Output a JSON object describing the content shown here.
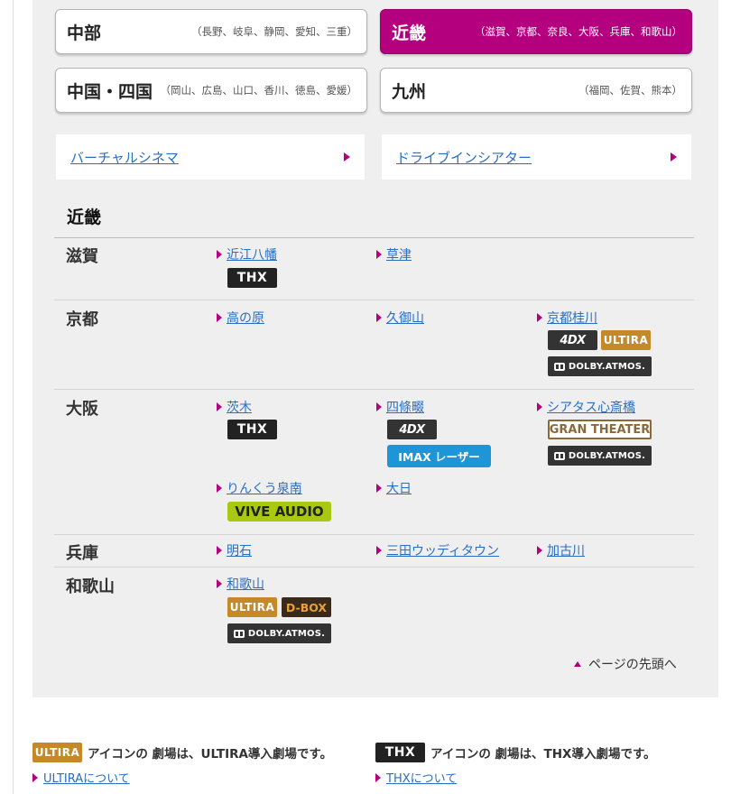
{
  "regions": [
    {
      "name": "中部",
      "prefs": "（長野、岐阜、静岡、愛知、三重）",
      "active": false
    },
    {
      "name": "近畿",
      "prefs": "（滋賀、京都、奈良、大阪、兵庫、和歌山）",
      "active": true
    },
    {
      "name": "中国・四国",
      "prefs": "（岡山、広島、山口、香川、徳島、愛媛）",
      "active": false
    },
    {
      "name": "九州",
      "prefs": "（福岡、佐賀、熊本）",
      "active": false
    }
  ],
  "special_links": [
    "バーチャルシネマ",
    "ドライブインシアター"
  ],
  "section_title": "近畿",
  "prefectures": [
    {
      "name": "滋賀",
      "theaters": [
        {
          "name": "近江八幡",
          "badges": [
            "THX"
          ]
        },
        {
          "name": "草津",
          "badges": []
        }
      ]
    },
    {
      "name": "京都",
      "theaters": [
        {
          "name": "高の原",
          "badges": []
        },
        {
          "name": "久御山",
          "badges": []
        },
        {
          "name": "京都桂川",
          "badges": [
            "4DX",
            "ULTIRA",
            "DOLBY ATMOS"
          ]
        }
      ]
    },
    {
      "name": "大阪",
      "theaters": [
        {
          "name": "茨木",
          "badges": [
            "THX"
          ]
        },
        {
          "name": "四條畷",
          "badges": [
            "4DX",
            "IMAX レーザー"
          ]
        },
        {
          "name": "シアタス心斎橋",
          "badges": [
            "GRAN THEATER",
            "DOLBY ATMOS"
          ]
        },
        {
          "name": "りんくう泉南",
          "badges": [
            "VIVE AUDIO"
          ]
        },
        {
          "name": "大日",
          "badges": []
        }
      ]
    },
    {
      "name": "兵庫",
      "theaters": [
        {
          "name": "明石",
          "badges": []
        },
        {
          "name": "三田ウッディタウン",
          "badges": []
        },
        {
          "name": "加古川",
          "badges": []
        }
      ]
    },
    {
      "name": "和歌山",
      "theaters": [
        {
          "name": "和歌山",
          "badges": [
            "ULTIRA",
            "D-BOX",
            "DOLBY ATMOS"
          ]
        }
      ]
    }
  ],
  "badge_labels": {
    "thx": "THX",
    "fourdx": "4DX",
    "ultira": "ULTIRA",
    "dolby": "DOLBY.ATMOS.",
    "gran": "GRAN THEATER",
    "imax": "IMAX レーザー",
    "vive": "VIVE AUDIO",
    "dbox": "D-BOX"
  },
  "page_top": "ページの先頭へ",
  "legend": [
    {
      "badge": "ULTIRA",
      "text": "アイコンの 劇場は、ULTIRA導入劇場です。",
      "link": "ULTIRAについて"
    },
    {
      "badge": "THX",
      "text": "アイコンの 劇場は、THX導入劇場です。",
      "link": "THXについて"
    }
  ],
  "colors": {
    "accent": "#b4007e",
    "link": "#2a6ec2",
    "panel": "#efefef"
  }
}
